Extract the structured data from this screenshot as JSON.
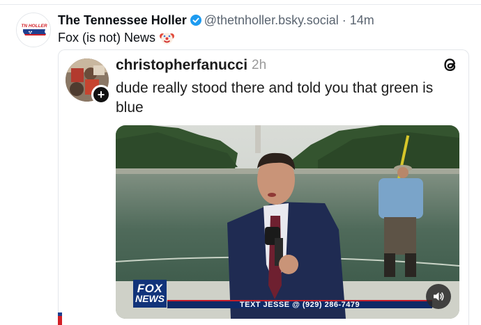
{
  "post": {
    "author_name": "The Tennessee Holler",
    "author_handle": "@thetnholler.bsky.social",
    "separator": "·",
    "time_ago": "14m",
    "text": "Fox (is not) News",
    "avatar_logo_text": "TN HOLLER",
    "verified_icon": "verified-check-icon",
    "emoji_icon": "clown-face-icon"
  },
  "embed": {
    "username": "christopherfanucci",
    "time_ago": "2h",
    "text": "dude really stood there and told you that green is blue",
    "follow_symbol": "+",
    "platform_icon": "threads-icon",
    "video": {
      "network_logo_top": "FOX",
      "network_logo_bottom": "NEWS",
      "ticker_text": "TEXT JESSE @ (929) 286-7479",
      "sound_icon": "speaker-icon"
    }
  },
  "colors": {
    "verified_blue": "#1d9bf0",
    "fox_blue": "#11337a",
    "fox_red": "#c41e2a",
    "tn_red": "#d21f26",
    "tn_blue": "#1f3f8f"
  }
}
